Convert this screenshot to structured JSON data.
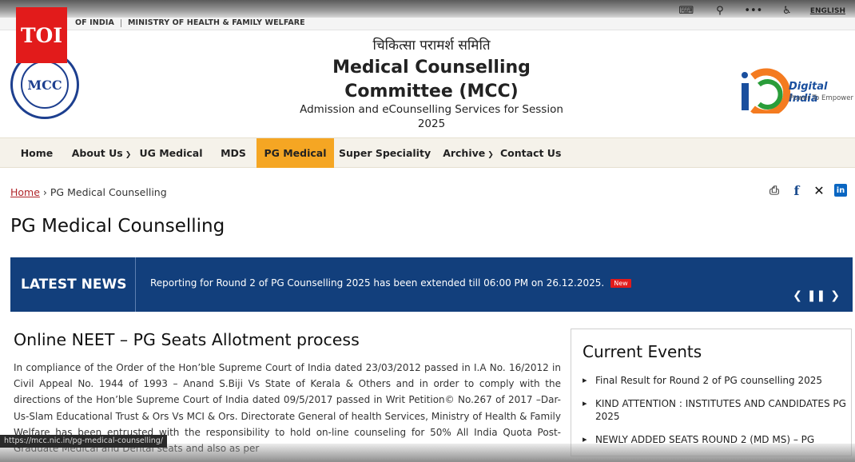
{
  "topbar": {
    "links": [
      "OF INDIA",
      "MINISTRY OF HEALTH & FAMILY WELFARE"
    ],
    "lang": "ENGLISH"
  },
  "badge": {
    "text": "TOI"
  },
  "logo": {
    "text": "MCC"
  },
  "header": {
    "hindi": "चिकित्सा परामर्श समिति",
    "title": "Medical Counselling Committee (MCC)",
    "subtitle": "Admission and eCounselling Services for Session 2025"
  },
  "digital_india": {
    "name": "Digital India",
    "tagline": "Power To Empower"
  },
  "nav": {
    "items": [
      "Home",
      "About Us",
      "UG Medical",
      "MDS",
      "PG Medical",
      "Super Speciality",
      "Archive",
      "Contact Us"
    ],
    "active": "PG Medical"
  },
  "breadcrumb": {
    "home": "Home",
    "separator": "›",
    "current": "PG Medical Counselling"
  },
  "page_title": "PG Medical Counselling",
  "news": {
    "label": "LATEST NEWS",
    "text": "Reporting for Round 2 of PG Counselling 2025 has been extended till 06:00 PM on 26.12.2025.",
    "badge": "New"
  },
  "article": {
    "title": "Online NEET – PG Seats Allotment process",
    "body": "In compliance of the Order of the Hon’ble Supreme Court of India dated 23/03/2012 passed in I.A No. 16/2012 in Civil Appeal No. 1944 of 1993 – Anand S.Biji Vs State of Kerala & Others and in order to comply with the directions of the Hon’ble Supreme Court of India dated 09/5/2017 passed in Writ Petition© No.267 of 2017 –Dar-Us-Slam Educational Trust & Ors Vs MCI & Ors. Directorate General of health Services, Ministry of Health & Family Welfare has been entrusted with the responsibility to hold on-line counseling for 50% All India Quota Post-Graduate Medical and Dental seats and also as per"
  },
  "events": {
    "title": "Current Events",
    "items": [
      "Final Result for Round 2 of PG counselling 2025",
      "KIND ATTENTION : INSTITUTES AND CANDIDATES PG 2025",
      "NEWLY ADDED SEATS ROUND 2 (MD MS) – PG"
    ]
  },
  "status_url": "https://mcc.nic.in/pg-medical-counselling/",
  "colors": {
    "nav_active": "#f5a623",
    "news_bg": "#123f7c",
    "badge_red": "#e21b1b",
    "link": "#b0252a"
  }
}
